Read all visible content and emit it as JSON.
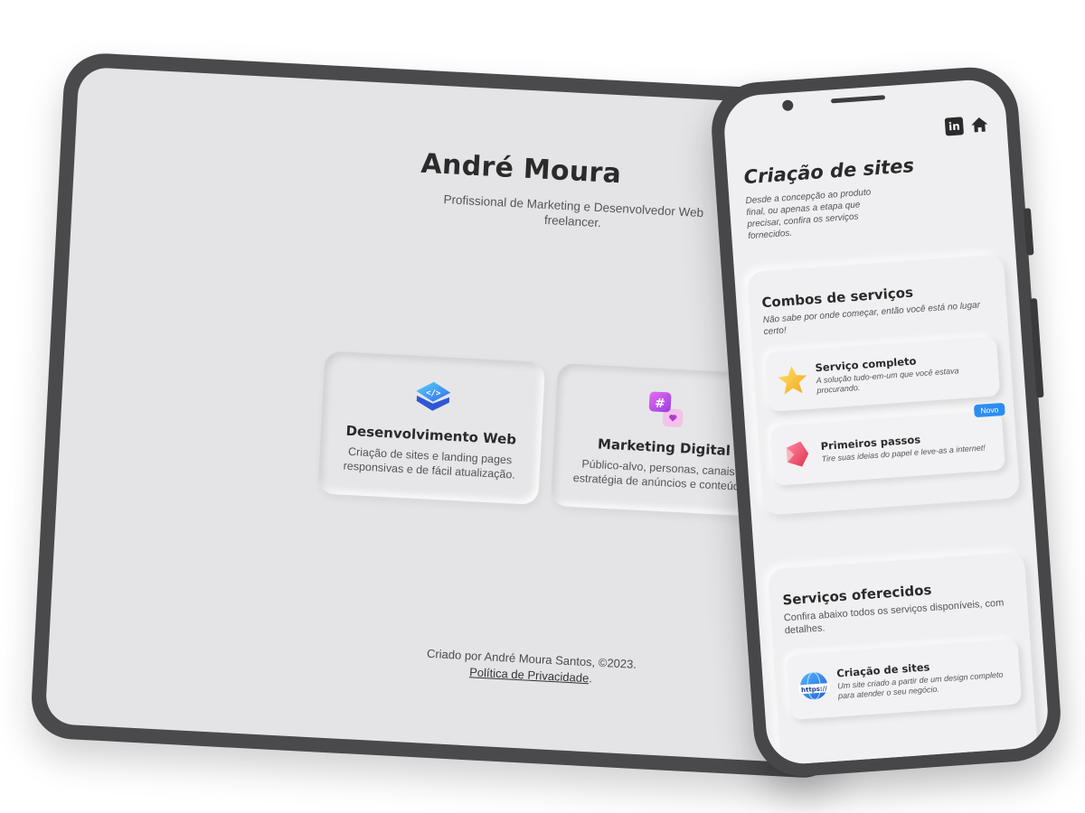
{
  "tablet": {
    "header": {
      "name": "André Moura",
      "subtitle": "Profissional de Marketing e Desenvolvedor Web freelancer."
    },
    "cards": [
      {
        "icon": "layers-code-icon",
        "title": "Desenvolvimento Web",
        "description": "Criação de sites e landing pages responsivas e de fácil atualização."
      },
      {
        "icon": "hashtag-chat-icon",
        "title": "Marketing Digital",
        "description": "Público-alvo, personas, canais e estratégia de anúncios e conteúdos"
      }
    ],
    "footer": {
      "copyright": "Criado por André Moura Santos, ©2023.",
      "privacy_link": "Política de Privacidade",
      "period": "."
    }
  },
  "phone": {
    "header_icons": {
      "linkedin_label": "in",
      "home": "home-icon"
    },
    "title": "Criação de sites",
    "intro": "Desde a concepção ao produto final, ou apenas a etapa que precisar, confira os serviços fornecidos.",
    "combos": {
      "title": "Combos de serviços",
      "description": "Não sabe por onde começar, então você está no lugar certo!",
      "items": [
        {
          "icon": "star-icon",
          "title": "Serviço completo",
          "description": "A solução tudo-em-um que você estava procurando."
        },
        {
          "icon": "bookmark-pages-icon",
          "title": "Primeiros passos",
          "description": "Tire suas ideias do papel e leve-as a internet!",
          "badge": "Novo"
        }
      ]
    },
    "services": {
      "title": "Serviços oferecidos",
      "description": "Confira abaixo todos os serviços disponíveis, com detalhes.",
      "items": [
        {
          "icon": "globe-https-icon",
          "icon_label": "https://",
          "title": "Criação de sites",
          "description": "Um site criado a partir de um design completo para atender o seu negócio."
        }
      ]
    }
  },
  "colors": {
    "frame": "#474749",
    "tablet_bg": "#e4e4e6",
    "phone_bg": "#efeff1",
    "badge": "#2c8df0"
  }
}
